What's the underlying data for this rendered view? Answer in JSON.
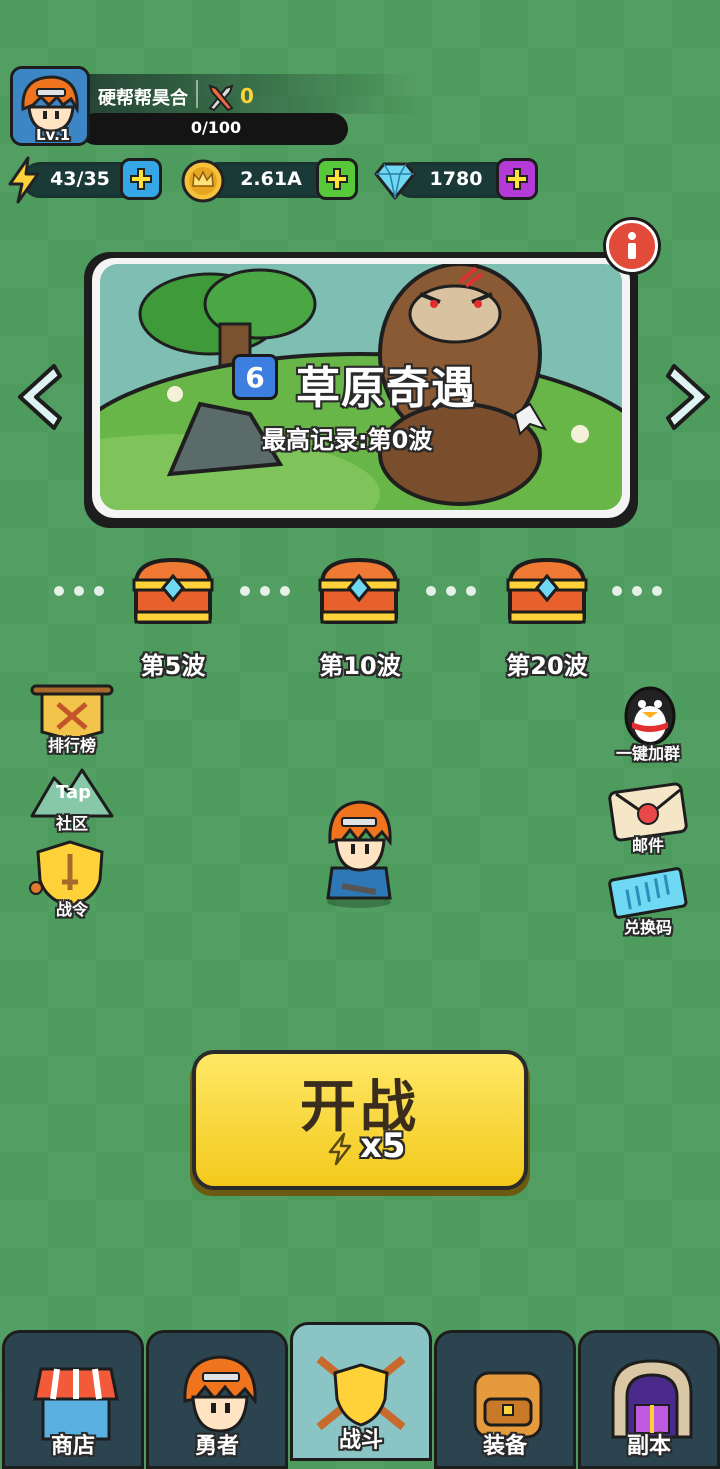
{
  "player": {
    "name": "硬帮帮昊合",
    "level": "Lv.1",
    "power": "0",
    "exp": "0/100"
  },
  "resources": {
    "energy": "43/35",
    "gold": "2.61A",
    "gems": "1780"
  },
  "stage": {
    "number": "6",
    "title": "草原奇遇",
    "record": "最高记录:第0波"
  },
  "rewards": [
    {
      "label": "第5波"
    },
    {
      "label": "第10波"
    },
    {
      "label": "第20波"
    }
  ],
  "left_buttons": {
    "ranking": "排行榜",
    "community": "社区",
    "tap_text": "Tap",
    "pass": "战令"
  },
  "right_buttons": {
    "group": "一键加群",
    "mail": "邮件",
    "redeem": "兑换码"
  },
  "fight": {
    "label": "开战",
    "cost": "x5"
  },
  "nav": {
    "shop": "商店",
    "hero": "勇者",
    "battle": "战斗",
    "equip": "装备",
    "dungeon": "副本"
  },
  "colors": {
    "background": "#4d9b5d",
    "fight_button": "#f3c91c",
    "nav_active": "#8ac4c4"
  }
}
